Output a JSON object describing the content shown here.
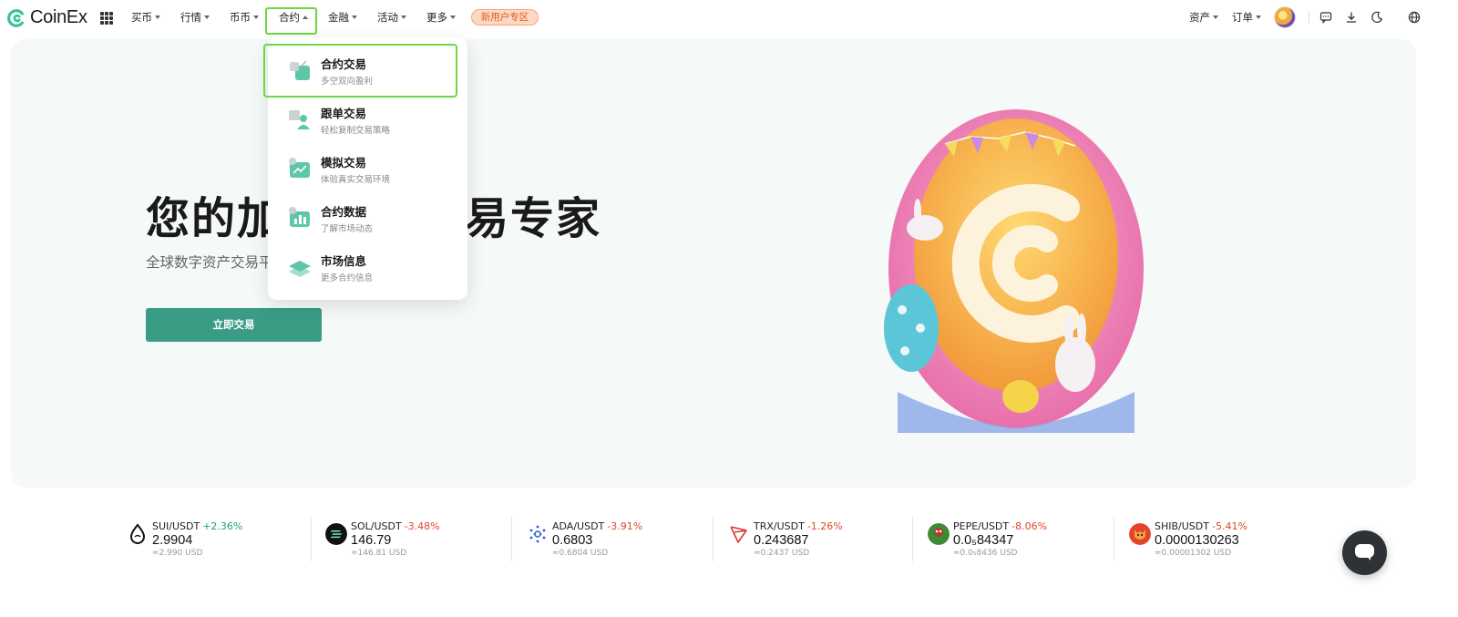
{
  "brand": {
    "name": "CoinEx",
    "color": "#3a9c85"
  },
  "nav": {
    "items": [
      {
        "label": "买币",
        "caret": "down"
      },
      {
        "label": "行情",
        "caret": "down"
      },
      {
        "label": "币币",
        "caret": "down"
      },
      {
        "label": "合约",
        "caret": "up",
        "active": true
      },
      {
        "label": "金融",
        "caret": "down"
      },
      {
        "label": "活动",
        "caret": "down"
      },
      {
        "label": "更多",
        "caret": "down"
      }
    ],
    "promo": "新用户专区",
    "right": [
      {
        "label": "资产"
      },
      {
        "label": "订单"
      }
    ],
    "tools": [
      "chat-icon",
      "download-icon",
      "moon-icon",
      "globe-icon"
    ]
  },
  "dropdown": {
    "items": [
      {
        "title": "合约交易",
        "desc": "多空双向盈利",
        "icon": "contract-icon",
        "highlighted": true
      },
      {
        "title": "跟单交易",
        "desc": "轻松复制交易策略",
        "icon": "copy-trade-icon"
      },
      {
        "title": "模拟交易",
        "desc": "体验真实交易环境",
        "icon": "demo-trade-icon"
      },
      {
        "title": "合约数据",
        "desc": "了解市场动态",
        "icon": "contract-data-icon"
      },
      {
        "title": "市场信息",
        "desc": "更多合约信息",
        "icon": "market-info-icon"
      }
    ]
  },
  "hero": {
    "title": "您的加密货币交易专家",
    "subtitle": "全球数字资产交易平台",
    "cta": "立即交易"
  },
  "ticker": [
    {
      "pair": "SUI/USDT",
      "change": "+2.36%",
      "direction": "up",
      "price": "2.9904",
      "fiat": "≈2.990 USD",
      "icon": "sui-icon"
    },
    {
      "pair": "SOL/USDT",
      "change": "-3.48%",
      "direction": "down",
      "price": "146.79",
      "fiat": "≈146.81 USD",
      "icon": "sol-icon"
    },
    {
      "pair": "ADA/USDT",
      "change": "-3.91%",
      "direction": "down",
      "price": "0.6803",
      "fiat": "≈0.6804 USD",
      "icon": "ada-icon"
    },
    {
      "pair": "TRX/USDT",
      "change": "-1.26%",
      "direction": "down",
      "price": "0.243687",
      "fiat": "≈0.2437 USD",
      "icon": "trx-icon"
    },
    {
      "pair": "PEPE/USDT",
      "change": "-8.06%",
      "direction": "down",
      "price": "0.0₅84347",
      "fiat": "≈0.0₅8436 USD",
      "icon": "pepe-icon"
    },
    {
      "pair": "SHIB/USDT",
      "change": "-5.41%",
      "direction": "down",
      "price": "0.0000130263",
      "fiat": "≈0.00001302 USD",
      "icon": "shib-icon"
    }
  ],
  "colors": {
    "up": "#1f9e72",
    "down": "#e0462c",
    "highlight": "#6ad940"
  }
}
